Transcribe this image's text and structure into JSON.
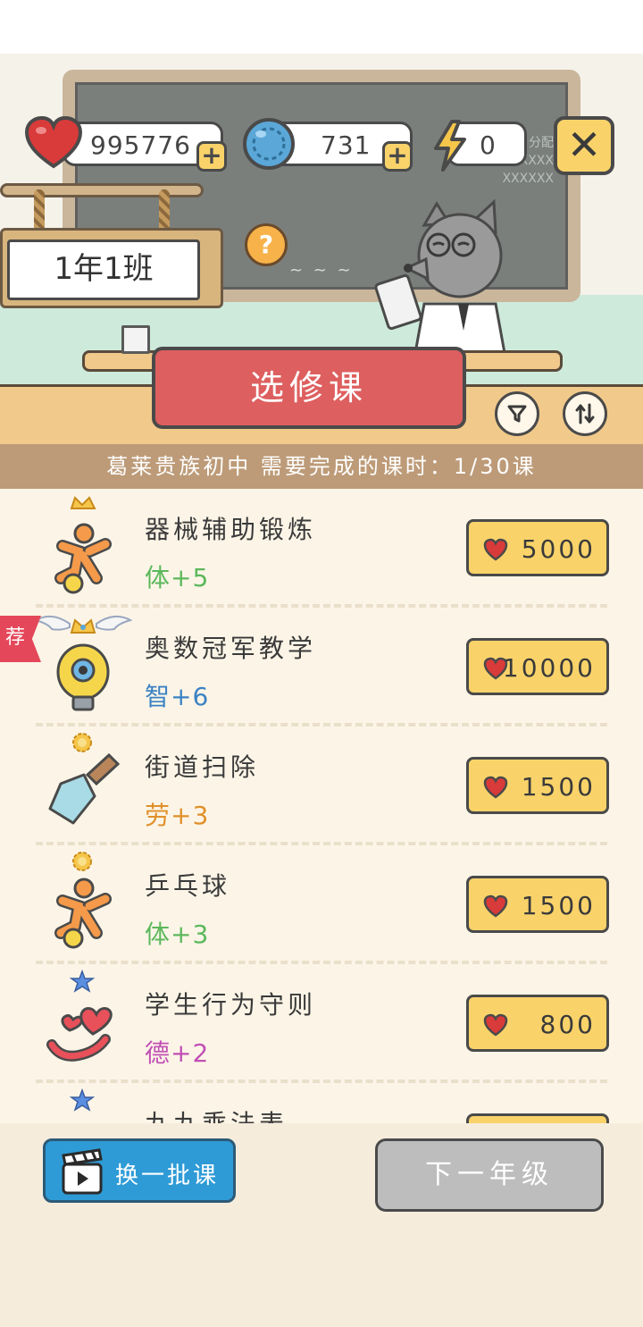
{
  "resources": {
    "hearts": "995776",
    "coins": "731",
    "energy": "0"
  },
  "chalkboard": {
    "line1": "每日分配",
    "line2": "XXXX",
    "line3": "XXXXXX"
  },
  "class_sign": "1年1班",
  "header": {
    "title": "选修课",
    "help": "?"
  },
  "info_bar": "葛莱贵族初中 需要完成的课时：1/30课",
  "recommend_tag": "荐",
  "colors": {
    "body": "#5cb85c",
    "intellect": "#3b82c4",
    "labor": "#e0902a",
    "morality": "#c14fb5",
    "price_button": "#f9d36a",
    "title_banner": "#de5f5f"
  },
  "courses": [
    {
      "name": "器械辅助锻炼",
      "stat": "体+5",
      "stat_type": "body",
      "price": "5000",
      "rank_icon": "crown-icon",
      "icon": "person-icon"
    },
    {
      "name": "奥数冠军教学",
      "stat": "智+6",
      "stat_type": "intellect",
      "price": "10000",
      "rank_icon": "winged-crown-icon",
      "icon": "lightbulb-icon"
    },
    {
      "name": "街道扫除",
      "stat": "劳+3",
      "stat_type": "labor",
      "price": "1500",
      "rank_icon": "flower-badge-icon",
      "icon": "shovel-icon"
    },
    {
      "name": "乒乓球",
      "stat": "体+3",
      "stat_type": "body",
      "price": "1500",
      "rank_icon": "flower-badge-icon",
      "icon": "person-icon"
    },
    {
      "name": "学生行为守则",
      "stat": "德+2",
      "stat_type": "morality",
      "price": "800",
      "rank_icon": "star-icon",
      "icon": "hearts-icon"
    },
    {
      "name": "九九乘法表",
      "stat": "",
      "stat_type": "intellect",
      "price": "",
      "rank_icon": "star-icon",
      "icon": "lightbulb-icon"
    }
  ],
  "footer": {
    "swap_label": "换一批课",
    "next_label": "下一年级"
  }
}
